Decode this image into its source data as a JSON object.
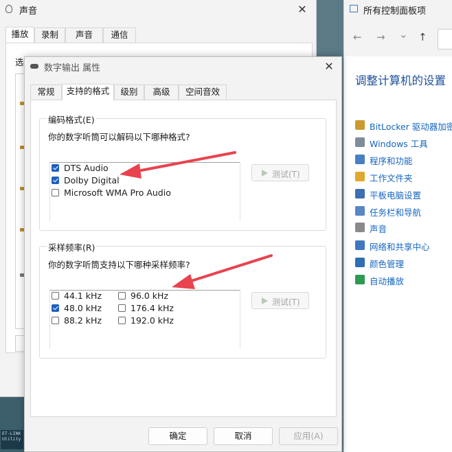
{
  "sound_window": {
    "title": "声音",
    "close_glyph": "✕",
    "tabs": [
      "播放",
      "录制",
      "声音",
      "通信"
    ],
    "select_label_partial": "选"
  },
  "control_panel": {
    "title": "所有控制面板项",
    "nav": {
      "back_glyph": "←",
      "forward_glyph": "→",
      "down_glyph": "⌄",
      "up_glyph": "↑"
    },
    "heading": "调整计算机的设置",
    "items": [
      {
        "label": "BitLocker 驱动器加密",
        "icon": "bitlocker-icon",
        "color": "#c99a2e"
      },
      {
        "label": "Windows 工具",
        "icon": "windows-tools-icon",
        "color": "#7f8c99"
      },
      {
        "label": "程序和功能",
        "icon": "programs-icon",
        "color": "#4a7fc1"
      },
      {
        "label": "工作文件夹",
        "icon": "work-folders-icon",
        "color": "#e0a82e"
      },
      {
        "label": "平板电脑设置",
        "icon": "tablet-icon",
        "color": "#3e6fb0"
      },
      {
        "label": "任务栏和导航",
        "icon": "taskbar-icon",
        "color": "#5a86c4"
      },
      {
        "label": "声音",
        "icon": "speaker-icon",
        "color": "#8a8a8a"
      },
      {
        "label": "网络和共享中心",
        "icon": "network-icon",
        "color": "#3f78c0"
      },
      {
        "label": "颜色管理",
        "icon": "color-management-icon",
        "color": "#2f6db5"
      },
      {
        "label": "自动播放",
        "icon": "autoplay-icon",
        "color": "#2e9a52"
      }
    ]
  },
  "props_window": {
    "title": "数字输出 属性",
    "close_glyph": "✕",
    "tabs": [
      {
        "label": "常规",
        "active": false
      },
      {
        "label": "支持的格式",
        "active": true
      },
      {
        "label": "级别",
        "active": false
      },
      {
        "label": "高级",
        "active": false
      },
      {
        "label": "空间音效",
        "active": false
      }
    ],
    "encoding": {
      "title": "编码格式(E)",
      "description": "你的数字听筒可以解码以下哪种格式?",
      "formats": [
        {
          "label": "DTS Audio",
          "checked": true
        },
        {
          "label": "Dolby Digital",
          "checked": true
        },
        {
          "label": "Microsoft WMA Pro Audio",
          "checked": false
        }
      ],
      "test_button": "测试(T)"
    },
    "sample_rate": {
      "title": "采样频率(R)",
      "description": "你的数字听筒支持以下哪种采样频率?",
      "rates": [
        {
          "label": "44.1 kHz",
          "checked": false
        },
        {
          "label": "48.0 kHz",
          "checked": true
        },
        {
          "label": "88.2 kHz",
          "checked": false
        },
        {
          "label": "96.0 kHz",
          "checked": false
        },
        {
          "label": "176.4 kHz",
          "checked": false
        },
        {
          "label": "192.0 kHz",
          "checked": false
        }
      ],
      "test_button": "测试(T)"
    },
    "buttons": {
      "ok": "确定",
      "cancel": "取消",
      "apply": "应用(A)"
    }
  },
  "taskbar_text": "ET-LINK Utility",
  "accent_color": "#1f5fbf",
  "annotation_color": "#e8434f"
}
